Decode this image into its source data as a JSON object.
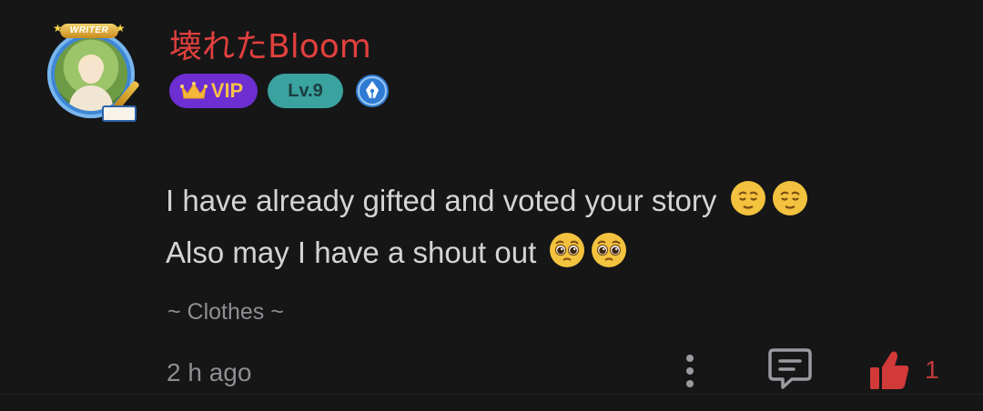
{
  "user": {
    "name": "壊れたBloom",
    "avatar_frame_label": "WRITER",
    "badges": {
      "vip_label": "VIP",
      "level_label": "Lv.9",
      "writer_icon": "pen-nib-icon"
    }
  },
  "comment": {
    "line1": "I have already gifted and voted your story",
    "line1_emoji": [
      "relieved-face-emoji",
      "relieved-face-emoji"
    ],
    "line2": "Also may I have a shout out",
    "line2_emoji": [
      "pleading-face-emoji",
      "pleading-face-emoji"
    ],
    "chapter_ref": "~ Clothes ~"
  },
  "footer": {
    "timestamp": "2 h ago",
    "like_count": "1",
    "icons": {
      "more": "more-vertical-icon",
      "reply": "reply-comment-icon",
      "like": "thumbs-up-icon"
    }
  },
  "colors": {
    "background": "#161617",
    "username": "#e0403d",
    "vip_badge": "#6d2fd2",
    "level_badge": "#3aa29f",
    "like_accent": "#d23a3a",
    "muted_text": "#8e8e93"
  }
}
